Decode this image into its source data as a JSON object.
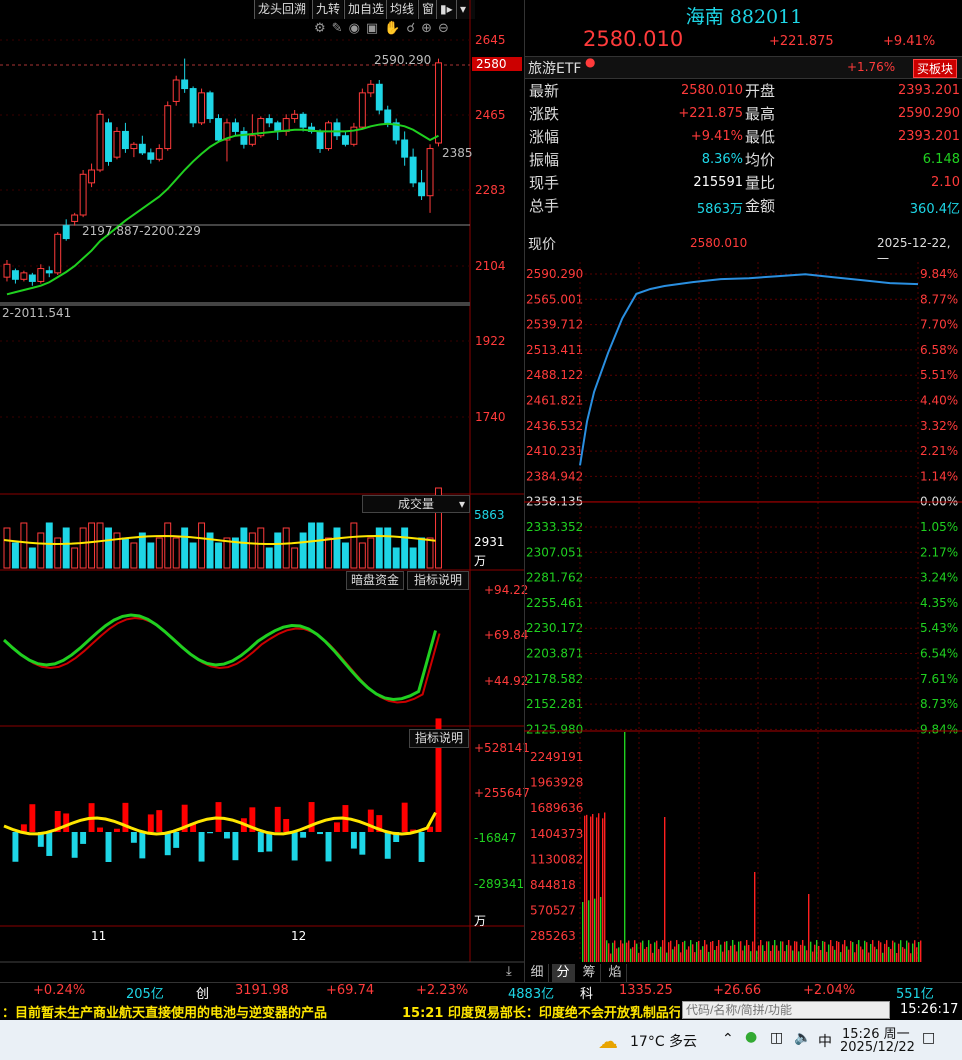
{
  "toolbar": {
    "buttons": [
      "龙头回溯",
      "九转",
      "加自选",
      "均线",
      "窗"
    ],
    "icons": [
      "pin-icon",
      "expand-icon"
    ]
  },
  "kline": {
    "price_labels": [
      "2645",
      "2465",
      "2283",
      "2104",
      "1922",
      "1740"
    ],
    "current_tag": "2580",
    "high_label": "2590.290",
    "low_label": "2385",
    "range_label": "2197.887-2200.229",
    "range_label2": "2-2011.541",
    "month_labels": [
      "11",
      "12"
    ],
    "candles": [
      {
        "o": 2080,
        "c": 2110,
        "h": 2120,
        "l": 2070,
        "up": true
      },
      {
        "o": 2095,
        "c": 2075,
        "h": 2100,
        "l": 2065,
        "up": false
      },
      {
        "o": 2075,
        "c": 2090,
        "h": 2095,
        "l": 2070,
        "up": true
      },
      {
        "o": 2085,
        "c": 2070,
        "h": 2090,
        "l": 2060,
        "up": false
      },
      {
        "o": 2070,
        "c": 2100,
        "h": 2110,
        "l": 2065,
        "up": true
      },
      {
        "o": 2095,
        "c": 2090,
        "h": 2105,
        "l": 2080,
        "up": false
      },
      {
        "o": 2090,
        "c": 2180,
        "h": 2185,
        "l": 2085,
        "up": true
      },
      {
        "o": 2170,
        "c": 2200,
        "h": 2215,
        "l": 2165,
        "up": false
      },
      {
        "o": 2210,
        "c": 2225,
        "h": 2230,
        "l": 2200,
        "up": true
      },
      {
        "o": 2225,
        "c": 2320,
        "h": 2330,
        "l": 2220,
        "up": true
      },
      {
        "o": 2300,
        "c": 2330,
        "h": 2345,
        "l": 2290,
        "up": true
      },
      {
        "o": 2330,
        "c": 2460,
        "h": 2470,
        "l": 2325,
        "up": true
      },
      {
        "o": 2440,
        "c": 2350,
        "h": 2450,
        "l": 2340,
        "up": false
      },
      {
        "o": 2360,
        "c": 2420,
        "h": 2430,
        "l": 2355,
        "up": true
      },
      {
        "o": 2420,
        "c": 2380,
        "h": 2440,
        "l": 2370,
        "up": false
      },
      {
        "o": 2380,
        "c": 2390,
        "h": 2395,
        "l": 2360,
        "up": true
      },
      {
        "o": 2390,
        "c": 2370,
        "h": 2410,
        "l": 2365,
        "up": false
      },
      {
        "o": 2370,
        "c": 2355,
        "h": 2380,
        "l": 2345,
        "up": false
      },
      {
        "o": 2355,
        "c": 2380,
        "h": 2390,
        "l": 2350,
        "up": true
      },
      {
        "o": 2380,
        "c": 2480,
        "h": 2490,
        "l": 2375,
        "up": true
      },
      {
        "o": 2490,
        "c": 2540,
        "h": 2550,
        "l": 2480,
        "up": true
      },
      {
        "o": 2540,
        "c": 2520,
        "h": 2590,
        "l": 2510,
        "up": false
      },
      {
        "o": 2520,
        "c": 2440,
        "h": 2525,
        "l": 2430,
        "up": false
      },
      {
        "o": 2440,
        "c": 2510,
        "h": 2520,
        "l": 2435,
        "up": true
      },
      {
        "o": 2510,
        "c": 2450,
        "h": 2515,
        "l": 2440,
        "up": false
      },
      {
        "o": 2450,
        "c": 2400,
        "h": 2460,
        "l": 2395,
        "up": false
      },
      {
        "o": 2400,
        "c": 2440,
        "h": 2450,
        "l": 2350,
        "up": true
      },
      {
        "o": 2440,
        "c": 2420,
        "h": 2450,
        "l": 2410,
        "up": false
      },
      {
        "o": 2420,
        "c": 2390,
        "h": 2430,
        "l": 2380,
        "up": false
      },
      {
        "o": 2390,
        "c": 2410,
        "h": 2460,
        "l": 2385,
        "up": true
      },
      {
        "o": 2410,
        "c": 2450,
        "h": 2455,
        "l": 2405,
        "up": true
      },
      {
        "o": 2450,
        "c": 2440,
        "h": 2460,
        "l": 2430,
        "up": false
      },
      {
        "o": 2440,
        "c": 2420,
        "h": 2445,
        "l": 2400,
        "up": false
      },
      {
        "o": 2420,
        "c": 2450,
        "h": 2460,
        "l": 2410,
        "up": true
      },
      {
        "o": 2450,
        "c": 2460,
        "h": 2470,
        "l": 2440,
        "up": true
      },
      {
        "o": 2460,
        "c": 2430,
        "h": 2465,
        "l": 2420,
        "up": false
      },
      {
        "o": 2430,
        "c": 2420,
        "h": 2440,
        "l": 2415,
        "up": false
      },
      {
        "o": 2420,
        "c": 2380,
        "h": 2425,
        "l": 2370,
        "up": false
      },
      {
        "o": 2380,
        "c": 2440,
        "h": 2445,
        "l": 2375,
        "up": true
      },
      {
        "o": 2440,
        "c": 2410,
        "h": 2450,
        "l": 2400,
        "up": false
      },
      {
        "o": 2410,
        "c": 2390,
        "h": 2420,
        "l": 2385,
        "up": false
      },
      {
        "o": 2390,
        "c": 2430,
        "h": 2440,
        "l": 2385,
        "up": true
      },
      {
        "o": 2430,
        "c": 2510,
        "h": 2520,
        "l": 2425,
        "up": true
      },
      {
        "o": 2510,
        "c": 2530,
        "h": 2540,
        "l": 2500,
        "up": true
      },
      {
        "o": 2530,
        "c": 2470,
        "h": 2540,
        "l": 2460,
        "up": false
      },
      {
        "o": 2470,
        "c": 2440,
        "h": 2480,
        "l": 2430,
        "up": false
      },
      {
        "o": 2440,
        "c": 2400,
        "h": 2450,
        "l": 2390,
        "up": false
      },
      {
        "o": 2400,
        "c": 2360,
        "h": 2420,
        "l": 2340,
        "up": false
      },
      {
        "o": 2360,
        "c": 2300,
        "h": 2380,
        "l": 2290,
        "up": false
      },
      {
        "o": 2300,
        "c": 2270,
        "h": 2330,
        "l": 2260,
        "up": false
      },
      {
        "o": 2270,
        "c": 2380,
        "h": 2390,
        "l": 2230,
        "up": true
      },
      {
        "o": 2393,
        "c": 2580,
        "h": 2590,
        "l": 2385,
        "up": true
      }
    ],
    "ma": [
      2040,
      2045,
      2050,
      2055,
      2060,
      2068,
      2080,
      2092,
      2106,
      2124,
      2142,
      2164,
      2180,
      2196,
      2212,
      2226,
      2240,
      2254,
      2268,
      2286,
      2308,
      2330,
      2350,
      2368,
      2384,
      2396,
      2404,
      2410,
      2412,
      2414,
      2416,
      2418,
      2420,
      2422,
      2424,
      2424,
      2422,
      2420,
      2420,
      2420,
      2420,
      2422,
      2426,
      2432,
      2436,
      2438,
      2436,
      2432,
      2424,
      2412,
      2400,
      2410
    ]
  },
  "volume_panel": {
    "title": "成交量",
    "labels": [
      "5863",
      "2931",
      "万"
    ]
  },
  "dark_money_panel": {
    "buttons": [
      "暗盘资金",
      "指标说明"
    ],
    "labels": [
      "+94.22",
      "+69.84",
      "+44.92"
    ]
  },
  "flow_panel": {
    "button": "指标说明",
    "labels": [
      "+528141",
      "+255647",
      "-16847",
      "-289341",
      "万"
    ]
  },
  "quote": {
    "name": "海南",
    "code": "882011",
    "price": "2580.010",
    "change": "+221.875",
    "pct": "+9.41%",
    "etf_name": "旅游ETF",
    "etf_pct": "+1.76%",
    "buy_button": "买板块",
    "rows": [
      {
        "l1": "最新",
        "v1": "2580.010",
        "l2": "开盘",
        "v2": "2393.201",
        "c1": "red",
        "c2": "red"
      },
      {
        "l1": "涨跌",
        "v1": "+221.875",
        "l2": "最高",
        "v2": "2590.290",
        "c1": "red",
        "c2": "red"
      },
      {
        "l1": "涨幅",
        "v1": "+9.41%",
        "l2": "最低",
        "v2": "2393.201",
        "c1": "red",
        "c2": "red"
      },
      {
        "l1": "振幅",
        "v1": "8.36%",
        "l2": "均价",
        "v2": "6.148",
        "c1": "cyan",
        "c2": "green"
      },
      {
        "l1": "现手",
        "v1": "215591",
        "l2": "量比",
        "v2": "2.10",
        "c1": "white",
        "c2": "red"
      },
      {
        "l1": "总手",
        "v1": "5863万",
        "l2": "金额",
        "v2": "360.4亿",
        "c1": "cyan",
        "c2": "cyan"
      }
    ]
  },
  "intraday": {
    "header_label": "现价",
    "header_price": "2580.010",
    "header_date": "2025-12-22,一",
    "price_ticks": [
      "2590.290",
      "2565.001",
      "2539.712",
      "2513.411",
      "2488.122",
      "2461.821",
      "2436.532",
      "2410.231",
      "2384.942",
      "2358.135",
      "2333.352",
      "2307.051",
      "2281.762",
      "2255.461",
      "2230.172",
      "2203.871",
      "2178.582",
      "2152.281",
      "2125.980"
    ],
    "pct_ticks": [
      "9.84%",
      "8.77%",
      "7.70%",
      "6.58%",
      "5.51%",
      "4.40%",
      "3.32%",
      "2.21%",
      "1.14%",
      "0.00%",
      "1.05%",
      "2.17%",
      "3.24%",
      "4.35%",
      "5.43%",
      "6.54%",
      "7.61%",
      "8.73%",
      "9.84%"
    ],
    "vol_ticks": [
      "2249191",
      "1963928",
      "1689636",
      "1404373",
      "1130082",
      "844818",
      "570527",
      "285263"
    ],
    "tabs": [
      "细",
      "分",
      "筹",
      "焰"
    ]
  },
  "chart_data": {
    "type": "line",
    "title": "海南 882011",
    "xlabel": "",
    "ylabel": "",
    "ylim": [
      2125.98,
      2590.29
    ],
    "series": [
      {
        "name": "现价",
        "x": [
          0,
          5,
          10,
          20,
          30,
          40,
          50,
          60,
          80,
          100,
          120,
          140,
          160,
          180,
          200,
          220,
          240
        ],
        "values": [
          2395,
          2440,
          2470,
          2510,
          2545,
          2570,
          2575,
          2578,
          2582,
          2585,
          2586,
          2588,
          2590,
          2587,
          2584,
          2581,
          2580
        ]
      }
    ]
  },
  "bottom_bar": {
    "items": [
      "+0.24%",
      "205亿",
      "创",
      "3191.98",
      "+69.74",
      "+2.23%",
      "4883亿",
      "科",
      "1335.25",
      "+26.66",
      "+2.04%",
      "551亿"
    ]
  },
  "news": {
    "left": "：目前暂未生产商业航天直接使用的电池与逆变器的产品",
    "right": "15:21 印度贸易部长：印度绝不会开放乳制品行",
    "search_placeholder": "代码/名称/简拼/功能",
    "time": "15:26:17"
  },
  "taskbar": {
    "weather": "17°C  多云",
    "ime": "中",
    "time": "15:26 周一",
    "date": "2025/12/22"
  }
}
